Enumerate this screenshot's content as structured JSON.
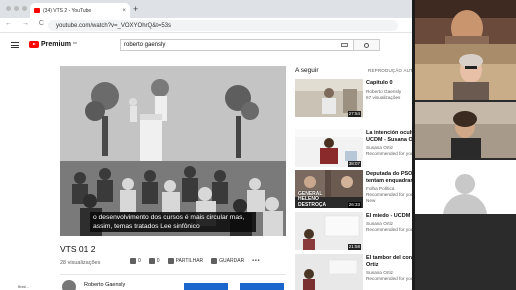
{
  "browser": {
    "tab_title": "(34) VTS 2 - YouTube",
    "tab_close": "×",
    "new_tab": "+",
    "url": "youtube.com/watch?v=_VOXYOhrQ&t=53s",
    "nav_buttons": "← → C"
  },
  "youtube": {
    "logo_text": "Premium",
    "logo_sup": "BR",
    "search_value": "roberto gaensly"
  },
  "video": {
    "caption": "o desenvolvimento dos cursos é mais circular mas, assim, temas tratados Lee sinfônico",
    "title": "VTS 01 2",
    "views": "28 visualizações",
    "likes": "0",
    "dislikes": "0",
    "share_label": "PARTILHAR",
    "save_label": "GUARDAR",
    "more": "•••",
    "channel_name": "Roberto Gaensly"
  },
  "sidebar": {
    "up_next": "A seguir",
    "autoplay": "REPRODUÇÃO AUTO",
    "items": [
      {
        "title": "Capitulo 0",
        "meta1": "Roberto Gaensly",
        "meta2": "67 visualizações",
        "duration": "27:54"
      },
      {
        "title": "La intención oculta",
        "title2": "UCDM - Susana Or",
        "meta1": "Susana Ortiz",
        "meta2": "Recommended for you",
        "duration": "38:07"
      },
      {
        "title": "Deputada do PSOL",
        "title2": "tentam enquadrar",
        "meta1": "Folha Política",
        "meta2": "Recommended for you",
        "meta3": "New",
        "duration": "26:33",
        "thumb_text": "GENERAL HELENO DESTROÇA"
      },
      {
        "title": "El miedo - UCDM - Susana Ortiz",
        "meta1": "Susana Ortiz",
        "meta2": "Recommended for you",
        "duration": "21:58"
      },
      {
        "title": "El tambor del corazón - Susana",
        "title2": "Ortiz",
        "meta1": "Susana Ortiz",
        "meta2": "Recommended for you"
      }
    ]
  },
  "status_bar": "Brasi...",
  "colors": {
    "brand_red": "#ff0000",
    "subscribe_blue": "#1a66cc",
    "call_panel": "#2b2b2b"
  }
}
